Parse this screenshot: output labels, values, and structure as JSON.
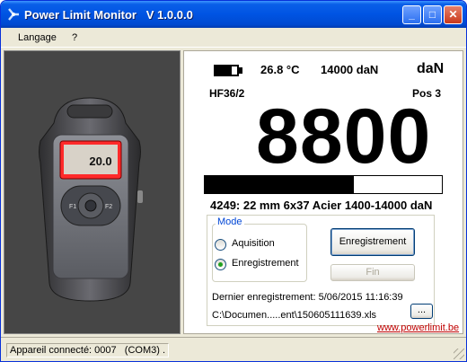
{
  "window": {
    "title": "Power Limit Monitor   V 1.0.0.0",
    "min_label": "_",
    "max_label": "□",
    "close_label": "✕"
  },
  "menu": {
    "items": [
      "Langage",
      "?"
    ]
  },
  "device": {
    "screen_value": "20.0"
  },
  "display": {
    "battery_level": 0.75,
    "temperature": "26.8 °C",
    "capacity": "14000 daN",
    "unit": "daN",
    "model": "HF36/2",
    "position": "Pos 3",
    "value": "8800",
    "progress_fraction": 0.63,
    "sling_info": "4249: 22 mm 6x37 Acier  1400-14000 daN"
  },
  "mode": {
    "legend": "Mode",
    "options": [
      "Aquisition",
      "Enregistrement"
    ],
    "selected": "Enregistrement"
  },
  "buttons": {
    "record": "Enregistrement",
    "finish": "Fin",
    "browse": "..."
  },
  "recording": {
    "last_record": "Dernier enregistrement: 5/06/2015 11:16:39",
    "file_path": "C:\\Documen.....ent\\150605111639.xls"
  },
  "website": "www.powerlimit.be",
  "status": {
    "text": "Appareil connecté: 0007   (COM3) ."
  },
  "colors": {
    "accent": "#0054e3",
    "link": "#c00000",
    "radio_selected": "#21a121"
  }
}
